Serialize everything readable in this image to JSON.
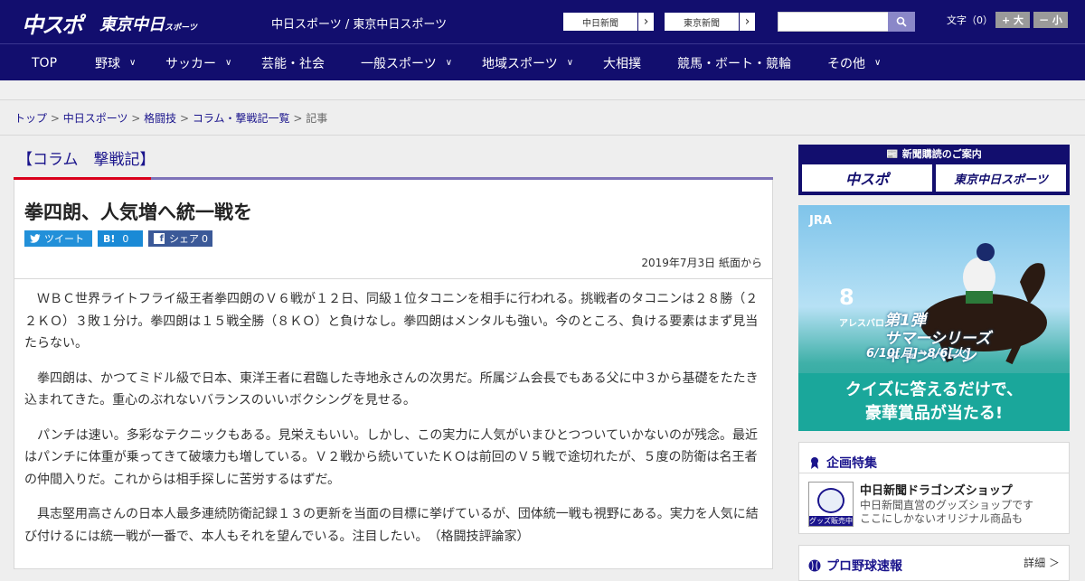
{
  "header": {
    "logo_main": "中スポ",
    "logo_tokyo": "東京中日",
    "logo_tokyo_small": "スポーツ",
    "site_links": "中日スポーツ / 東京中日スポーツ",
    "select_chunichi": "中日新聞",
    "select_tokyo": "東京新聞",
    "search_placeholder": "",
    "font_label": "文字（0）",
    "font_bigger": "+ 大",
    "font_smaller": "－ 小"
  },
  "nav": {
    "items": [
      {
        "label": "TOP",
        "chevron": false
      },
      {
        "label": "野球",
        "chevron": true
      },
      {
        "label": "サッカー",
        "chevron": true
      },
      {
        "label": "芸能・社会",
        "chevron": false
      },
      {
        "label": "一般スポーツ",
        "chevron": true
      },
      {
        "label": "地域スポーツ",
        "chevron": true
      },
      {
        "label": "大相撲",
        "chevron": false
      },
      {
        "label": "競馬・ボート・競輪",
        "chevron": false
      },
      {
        "label": "その他",
        "chevron": true
      }
    ]
  },
  "breadcrumb": {
    "items": [
      "トップ",
      "中日スポーツ",
      "格闘技",
      "コラム・撃戦記一覧"
    ],
    "sep": " > ",
    "current": "記事"
  },
  "column": {
    "title": "【コラム　撃戦記】"
  },
  "article": {
    "headline": "拳四朗、人気増へ統一戦を",
    "share_tweet": "ツイート",
    "share_hatena_count": "0",
    "share_fb": "シェア",
    "share_fb_count": "0",
    "date": "2019年7月3日 紙面から",
    "paragraphs": [
      "ＷＢＣ世界ライトフライ級王者拳四朗のＶ６戦が１２日、同級１位タコニンを相手に行われる。挑戦者のタコニンは２８勝（２２ＫＯ）３敗１分け。拳四朗は１５戦全勝（８ＫＯ）と負けなし。拳四朗はメンタルも強い。今のところ、負ける要素はまず見当たらない。",
      "拳四朗は、かつてミドル級で日本、東洋王者に君臨した寺地永さんの次男だ。所属ジム会長でもある父に中３から基礎をたたき込まれてきた。重心のぶれないバランスのいいボクシングを見せる。",
      "パンチは速い。多彩なテクニックもある。見栄えもいい。しかし、この実力に人気がいまひとつついていかないのが残念。最近はパンチに体重が乗ってきて破壊力も増している。Ｖ２戦から続いていたＫＯは前回のＶ５戦で途切れたが、５度の防衛は名王者の仲間入りだ。これからは相手探しに苦労するはずだ。",
      "具志堅用高さんの日本人最多連続防衛記録１３の更新を当面の目標に挙げているが、団体統一戦も視野にある。実力を人気に結び付けるには統一戦が一番で、本人もそれを望んでいる。注目したい。　（格闘技評論家）"
    ]
  },
  "sidebar": {
    "subscribe_title": "新聞購読のご案内",
    "subscribe_left": "中スポ",
    "subscribe_right": "東京中日スポーツ",
    "ad": {
      "brand": "JRA",
      "number": "8",
      "horse_name": "アレスバロー",
      "campaign_a": "第1弾",
      "campaign_b": "サマーシリーズ",
      "campaign_c": "キャンペーン",
      "period": "6/10[月]→8/6[火]",
      "quiz_line1": "クイズに答えるだけで、",
      "quiz_line2": "豪華賞品が当たる!"
    },
    "kikaku_title": "企画特集",
    "shop_title": "中日新聞ドラゴンズショップ",
    "shop_desc1": "中日新聞直営のグッズショップです",
    "shop_desc2": "ここにしかないオリジナル商品も",
    "shop_img_label": "グッズ販売中",
    "baseball_title": "プロ野球速報",
    "baseball_detail": "詳細 ＞"
  },
  "colors": {
    "brand_navy": "#120e6e",
    "accent_red": "#d9001b",
    "link_blue": "#1a148c"
  }
}
